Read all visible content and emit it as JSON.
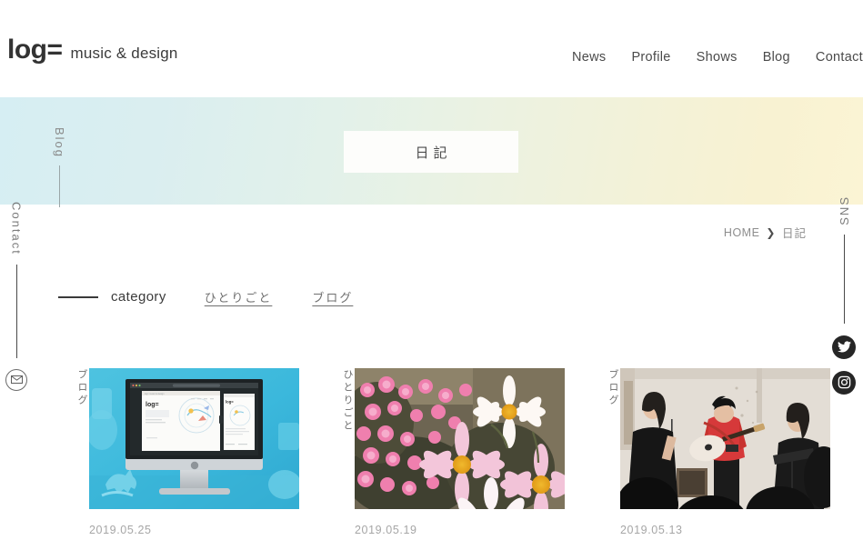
{
  "header": {
    "logo_mark": "log=",
    "logo_tagline": "music & design",
    "nav": [
      {
        "label": "News"
      },
      {
        "label": "Profile"
      },
      {
        "label": "Shows"
      },
      {
        "label": "Blog"
      },
      {
        "label": "Contact"
      }
    ]
  },
  "hero": {
    "title": "日記",
    "side_label": "Blog"
  },
  "rails": {
    "contact_label": "Contact",
    "contact_icon": "mail-envelope-icon",
    "sns_label": "SNS",
    "sns_icons": [
      {
        "name": "twitter-icon"
      },
      {
        "name": "instagram-icon"
      }
    ]
  },
  "breadcrumb": {
    "home": "HOME",
    "separator": "❯",
    "current": "日記"
  },
  "category": {
    "label": "category",
    "links": [
      {
        "label": "ひとりごと"
      },
      {
        "label": "ブログ"
      }
    ]
  },
  "posts": [
    {
      "category": "ブログ",
      "date": "2019.05.25",
      "image_name": "imac-desk-mockup-photo"
    },
    {
      "category": "ひとりごと",
      "date": "2019.05.19",
      "image_name": "pink-flowers-daisies-photo"
    },
    {
      "category": "ブログ",
      "date": "2019.05.13",
      "image_name": "live-band-performance-photo"
    }
  ],
  "colors": {
    "hero_gradient_start": "#d6eef3",
    "hero_gradient_end": "#fbf4d4",
    "text_primary": "#3c3c3c",
    "text_muted": "#a6a6a6",
    "sns_icon_bg": "#262626"
  }
}
